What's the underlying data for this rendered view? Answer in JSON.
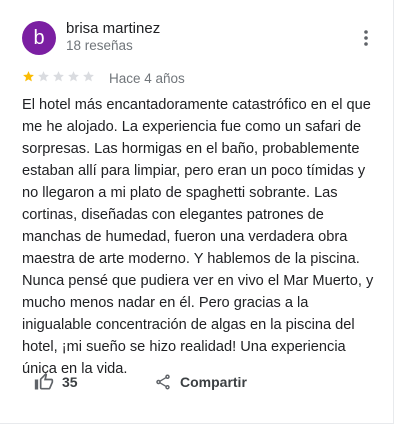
{
  "review": {
    "avatar_letter": "b",
    "avatar_color": "#7b1fa2",
    "author_name": "brisa martinez",
    "review_count": "18 reseñas",
    "rating": 1,
    "rating_max": 5,
    "star_filled_color": "#fbbc04",
    "star_empty_color": "#dadce0",
    "time_ago": "Hace 4 años",
    "text": "El hotel más encantadoramente catastrófico en el que me he alojado. La experiencia fue como un safari de sorpresas. Las hormigas en el baño, probablemente estaban allí para limpiar, pero eran un poco tímidas y no llegaron a mi plato de spaghetti sobrante. Las cortinas, diseñadas con elegantes patrones de manchas de humedad, fueron una verdadera obra maestra de arte moderno. Y hablemos de la piscina. Nunca pensé que pudiera ver en vivo el Mar Muerto, y mucho menos nadar en él. Pero gracias a la inigualable concentración de algas en la piscina del hotel, ¡mi sueño se hizo realidad! Una experiencia única en la vida."
  },
  "actions": {
    "like_count": "35",
    "share_label": "Compartir"
  },
  "icons": {
    "menu": "more-vert-icon",
    "like": "thumb-up-icon",
    "share": "share-icon"
  }
}
